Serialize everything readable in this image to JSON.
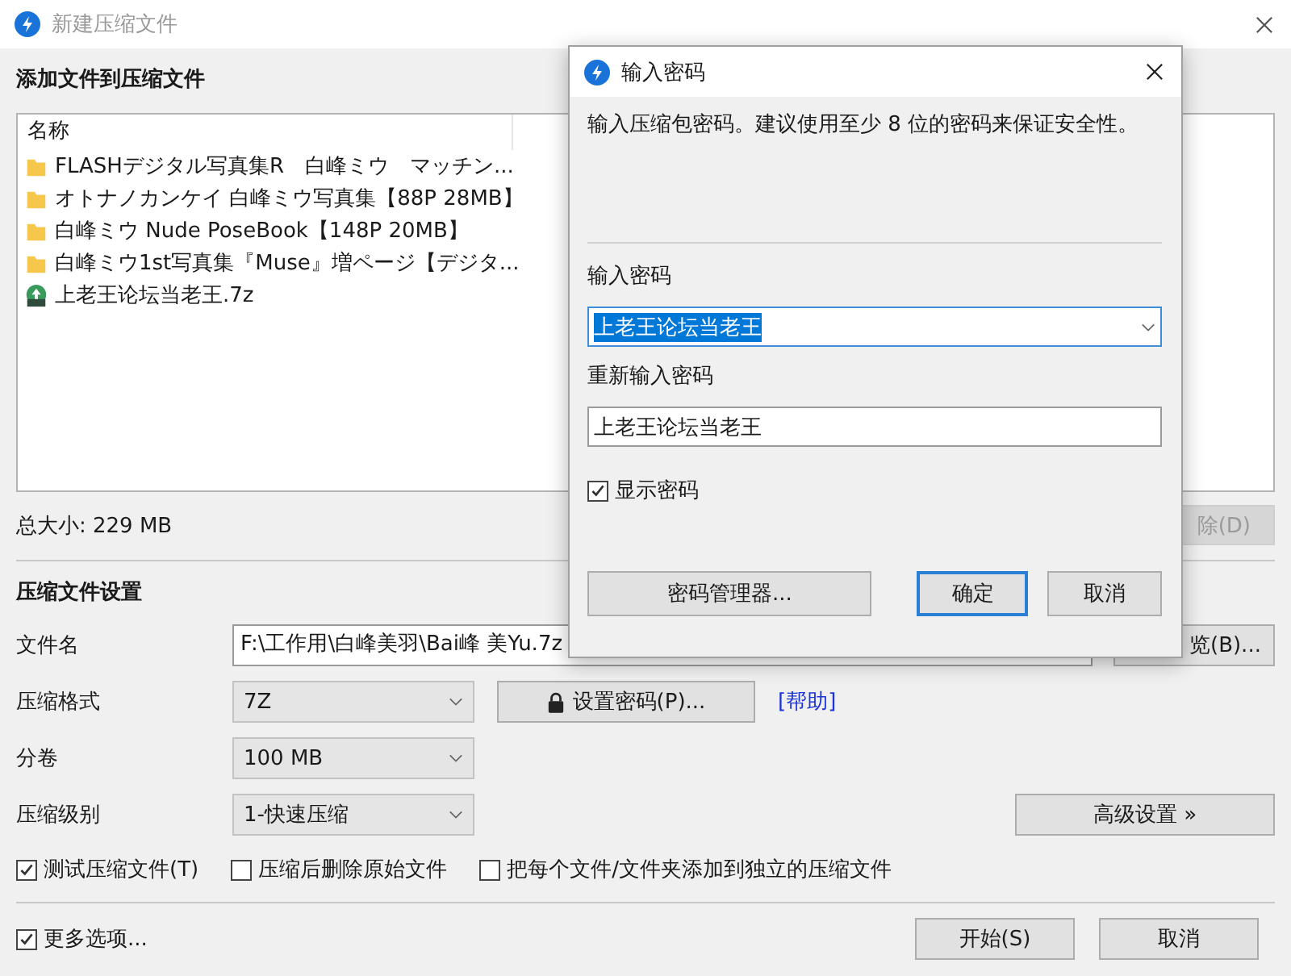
{
  "window": {
    "title": "新建压缩文件"
  },
  "files_section": {
    "heading": "添加文件到压缩文件",
    "column": "名称",
    "files": [
      {
        "kind": "folder",
        "name": "FLASHデジタル写真集R　白峰ミウ　マッチン..."
      },
      {
        "kind": "folder",
        "name": "オトナノカンケイ 白峰ミウ写真集【88P 28MB】"
      },
      {
        "kind": "folder",
        "name": "白峰ミウ  Nude PoseBook【148P 20MB】"
      },
      {
        "kind": "folder",
        "name": "白峰ミウ1st写真集『Muse』増ページ【デジタ..."
      },
      {
        "kind": "archive",
        "name": "上老王论坛当老王.7z"
      }
    ],
    "total": "总大小: 229 MB",
    "delete_button": {
      "label": "除(D)",
      "disabled": true
    }
  },
  "settings": {
    "heading": "压缩文件设置",
    "filename_label": "文件名",
    "filename": "F:\\工作用\\白峰美羽\\Bai峰 美Yu.7z",
    "browse_button": "览(B)...",
    "format_label": "压缩格式",
    "format": "7Z",
    "password_button": "设置密码(P)...",
    "help_link": "[帮助]",
    "split_label": "分卷",
    "split": "100 MB",
    "level_label": "压缩级别",
    "level": "1-快速压缩",
    "advanced_button": "高级设置 »",
    "options": [
      {
        "label": "测试压缩文件(T)",
        "checked": true
      },
      {
        "label": "压缩后删除原始文件",
        "checked": false
      },
      {
        "label": "把每个文件/文件夹添加到独立的压缩文件",
        "checked": false
      }
    ]
  },
  "footer": {
    "more_options": {
      "label": "更多选项...",
      "checked": true
    },
    "buttons": [
      "开始(S)",
      "取消"
    ]
  },
  "dialog": {
    "title": "输入密码",
    "description": "输入压缩包密码。建议使用至少 8 位的密码来保证安全性。",
    "password_label": "输入密码",
    "password": "上老王论坛当老王",
    "password_selected": true,
    "confirm_label": "重新输入密码",
    "confirm": "上老王论坛当老王",
    "show_password": {
      "label": "显示密码",
      "checked": true
    },
    "buttons": [
      {
        "label": "密码管理器...",
        "default": false
      },
      {
        "label": "确定",
        "default": true
      },
      {
        "label": "取消",
        "default": false
      }
    ]
  }
}
